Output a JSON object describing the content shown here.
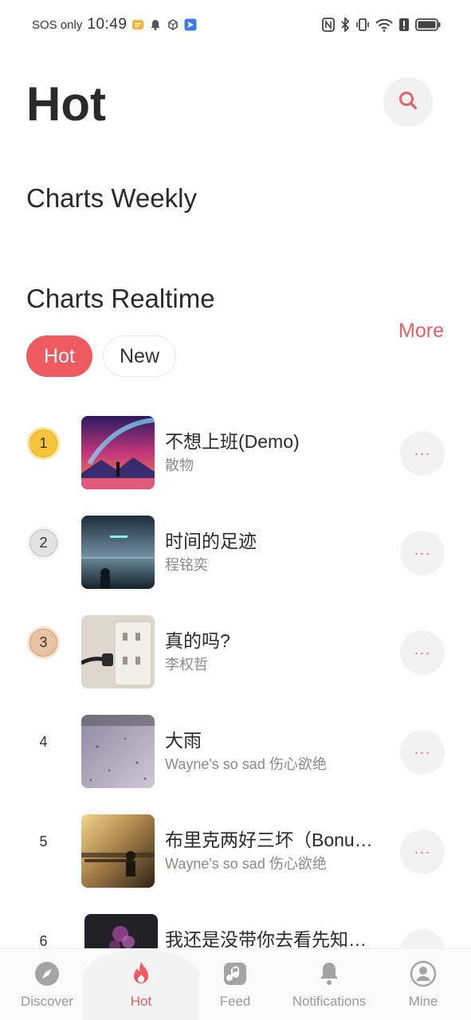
{
  "status_bar": {
    "carrier": "SOS only",
    "time": "10:49"
  },
  "header": {
    "title": "Hot",
    "search_icon": "search-icon"
  },
  "sections": {
    "weekly_title": "Charts Weekly",
    "realtime_title": "Charts Realtime",
    "more_label": "More"
  },
  "tabs": [
    {
      "label": "Hot",
      "active": true
    },
    {
      "label": "New",
      "active": false
    }
  ],
  "chart": [
    {
      "rank": "1",
      "title": "不想上班(Demo)",
      "artist": "散物"
    },
    {
      "rank": "2",
      "title": "时间的足迹",
      "artist": "程铭奕"
    },
    {
      "rank": "3",
      "title": "真的吗?",
      "artist": "李权哲"
    },
    {
      "rank": "4",
      "title": "大雨",
      "artist": "Wayne's so sad 伤心欲绝"
    },
    {
      "rank": "5",
      "title": "布里克两好三坏（Bonu…",
      "artist": "Wayne's so sad 伤心欲绝"
    },
    {
      "rank": "6",
      "title": "我还是没带你去看先知…",
      "artist": ""
    }
  ],
  "more_button_label": "···",
  "bottom_nav": [
    {
      "label": "Discover",
      "icon": "compass-icon",
      "active": false
    },
    {
      "label": "Hot",
      "icon": "flame-icon",
      "active": true
    },
    {
      "label": "Feed",
      "icon": "music-note-icon",
      "active": false
    },
    {
      "label": "Notifications",
      "icon": "bell-icon",
      "active": false
    },
    {
      "label": "Mine",
      "icon": "user-icon",
      "active": false
    }
  ],
  "colors": {
    "accent": "#ee5a60",
    "gold": "#f7c53b",
    "silver": "#e2e2e2",
    "bronze": "#e8c3a2"
  }
}
